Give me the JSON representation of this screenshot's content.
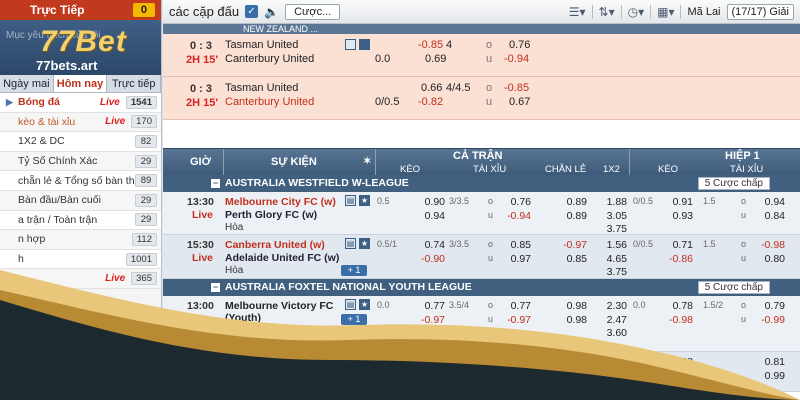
{
  "sidebar": {
    "live_label": "Trực Tiếp",
    "live_count": "0",
    "brand_logo": "77Bet",
    "brand_url": "77bets.art",
    "menu_hint": "Mục yêu thích của tôi",
    "tabs": [
      {
        "label": "Ngày mai"
      },
      {
        "label": "Hôm nay"
      },
      {
        "label": "Trực tiếp"
      }
    ],
    "items": [
      {
        "label": "Bóng đá",
        "live": "Live",
        "count": "1541"
      },
      {
        "label": "kèo & tài xỉu",
        "live": "Live",
        "count": "170"
      },
      {
        "label": "1X2 & DC",
        "live": "",
        "count": "82"
      },
      {
        "label": "Tỷ Số Chính Xác",
        "live": "",
        "count": "29"
      },
      {
        "label": "chẵn lẻ & Tổng số bàn thắng",
        "live": "",
        "count": "89"
      },
      {
        "label": "Bàn đầu/Bàn cuối",
        "live": "",
        "count": "29"
      },
      {
        "label": "a trận / Toàn trận",
        "live": "",
        "count": "29"
      },
      {
        "label": "n hợp",
        "live": "",
        "count": "112"
      },
      {
        "label": "h",
        "live": "",
        "count": "1001"
      },
      {
        "label": "",
        "live": "Live",
        "count": "365"
      }
    ]
  },
  "toolbar": {
    "title": "các cặp đấu",
    "bet_button": "Cược...",
    "odds_type": "Mã Lai",
    "pages": "(17/17) Giải"
  },
  "finished": {
    "header_text": "NEW ZEALAND ...",
    "rows": [
      {
        "score": "0 : 3",
        "ht": "2H 15'",
        "home": "Tasman United",
        "away": "Canterbury United",
        "hdp": "",
        "hdp2": "0.0",
        "odd1": "-0.85",
        "odd2": "0.69",
        "ou": "4",
        "ou1": "0.76",
        "ou2": "-0.94",
        "ou_u": "u",
        "ou_o": "o"
      },
      {
        "score": "0 : 3",
        "ht": "2H 15'",
        "home": "Tasman United",
        "away": "Canterbury United",
        "hdp": "",
        "hdp2": "0/0.5",
        "odd1": "0.66",
        "odd2": "-0.82",
        "ou": "4/4.5",
        "ou1": "-0.85",
        "ou2": "0.67",
        "ou_u": "u",
        "ou_o": "o"
      }
    ]
  },
  "table_header": {
    "time": "GIỜ",
    "event": "SỰ KIỆN",
    "full_match": "CẢ TRẬN",
    "first_half": "HIỆP 1",
    "cols_full": [
      "KÈO",
      "TÀI XỈU",
      "CHẴN LẺ",
      "1X2"
    ],
    "cols_half": [
      "KÈO",
      "TÀI XỈU"
    ]
  },
  "leagues": [
    {
      "name": "AUSTRALIA WESTFIELD W-LEAGUE",
      "more": "5 Cược chấp",
      "matches": [
        {
          "time": "13:30",
          "status": "Live",
          "home": "Melbourne City FC (w)",
          "away": "Perth Glory FC (w)",
          "draw": "Hòa",
          "hdp": "0.5",
          "h1": "0.90",
          "h2": "0.94",
          "ou": "3/3.5",
          "o": "o",
          "u": "u",
          "ou1": "0.76",
          "ou2": "-0.94",
          "oe1": "0.89",
          "oe2": "0.89",
          "x1": "1.88",
          "x2": "3.05",
          "x3": "3.75",
          "fh_hdp": "0/0.5",
          "fh1": "0.91",
          "fh2": "0.93",
          "fh_ou": "1.5",
          "fho1": "0.94",
          "fho2": "0.84",
          "home_red": true
        },
        {
          "time": "15:30",
          "status": "Live",
          "home": "Canberra United (w)",
          "away": "Adelaide United FC (w)",
          "draw": "Hòa",
          "hdp": "0.5/1",
          "h1": "0.74",
          "h2": "-0.90",
          "ou": "3/3.5",
          "o": "o",
          "u": "u",
          "ou1": "0.85",
          "ou2": "0.97",
          "oe1": "-0.97",
          "oe2": "0.85",
          "x1": "1.56",
          "x2": "4.65",
          "x3": "3.75",
          "fh_hdp": "0/0.5",
          "fh1": "0.71",
          "fh2": "-0.86",
          "fh_ou": "1.5",
          "fho1": "-0.98",
          "fho2": "0.80",
          "home_red": true
        }
      ]
    },
    {
      "name": "AUSTRALIA FOXTEL NATIONAL YOUTH LEAGUE",
      "more": "5 Cược chấp",
      "matches": [
        {
          "time": "13:00",
          "status": "Live",
          "home": "Melbourne Victory FC (Youth)",
          "away": "Brisbane Roar FC (Youth)",
          "draw": "",
          "hdp": "0.0",
          "h1": "0.77",
          "h2": "-0.97",
          "ou": "3.5/4",
          "o": "o",
          "u": "u",
          "ou1": "0.77",
          "ou2": "-0.97",
          "oe1": "0.98",
          "oe2": "0.98",
          "x1": "2.30",
          "x2": "2.47",
          "x3": "3.60",
          "fh_hdp": "0.0",
          "fh1": "0.78",
          "fh2": "-0.98",
          "fh_ou": "1.5/2",
          "fho1": "0.79",
          "fho2": "-0.99",
          "home_red": false
        },
        {
          "time": "",
          "status": "",
          "home": "",
          "away": "",
          "draw": "",
          "hdp": "",
          "h1": "",
          "h2": "",
          "ou": "",
          "o": "",
          "u": "",
          "ou1": "",
          "ou2": "",
          "oe1": "0.98",
          "oe2": "",
          "x1": "2.95",
          "x2": "",
          "x3": "",
          "fh_hdp": "",
          "fh1": "0.68",
          "fh2": "-0.88",
          "fh_ou": "",
          "fho1": "0.81",
          "fho2": "0.99",
          "home_red": false
        }
      ]
    }
  ],
  "colors": {
    "header_blue": "#3e5a79",
    "live_red": "#c23a1e",
    "wave_gold": "#d9b25a",
    "wave_dark": "#1c2a30"
  }
}
